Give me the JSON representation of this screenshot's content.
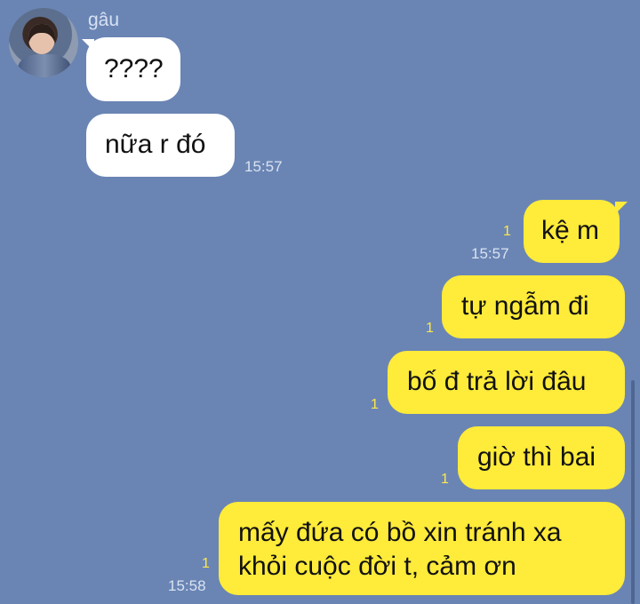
{
  "chat": {
    "sender_name": "gâu",
    "incoming": [
      {
        "text": "????"
      },
      {
        "text": "nữa r đó",
        "time": "15:57"
      }
    ],
    "outgoing": [
      {
        "text": "kệ m",
        "read": "1",
        "time": "15:57"
      },
      {
        "text": "tự ngẫm đi",
        "read": "1"
      },
      {
        "text": "bố đ trả lời đâu",
        "read": "1"
      },
      {
        "text": "giờ thì bai",
        "read": "1"
      },
      {
        "text_line1": "mấy đứa có bồ xin tránh xa",
        "text_line2": "khỏi cuộc đời t, cảm ơn",
        "read": "1",
        "time": "15:58"
      }
    ]
  }
}
